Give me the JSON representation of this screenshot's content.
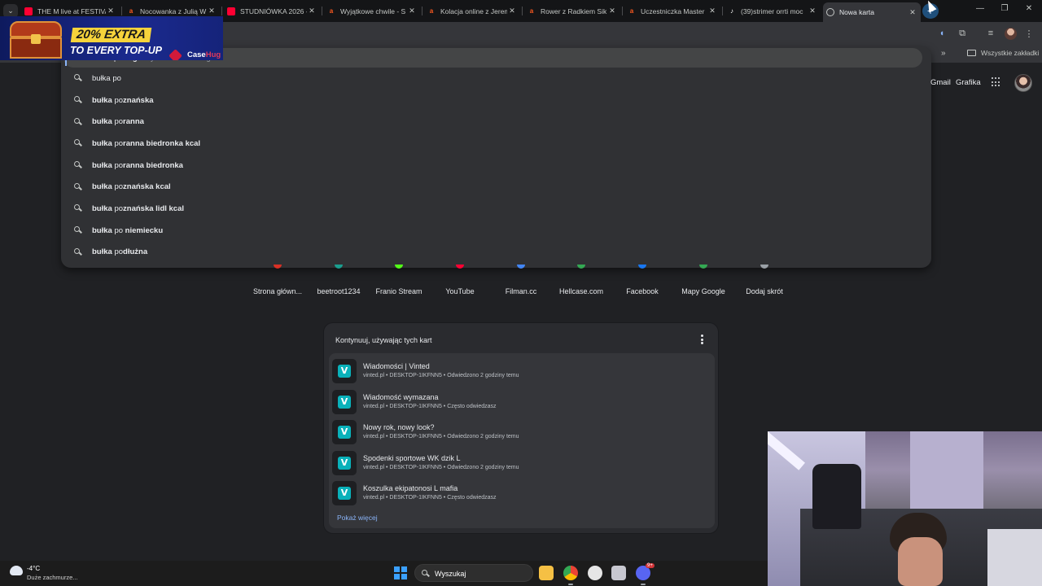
{
  "tabs": [
    {
      "label": "THE M live at FESTIVA",
      "favicon": "youtube-icon",
      "color": "#ff0033"
    },
    {
      "label": "Nocowanka z Julią W",
      "favicon": "kick-icon",
      "color": "#ff5a1f"
    },
    {
      "label": "STUDNIÓWKA 2026 -",
      "favicon": "youtube-icon",
      "color": "#ff0033"
    },
    {
      "label": "Wyjątkowe chwile - S",
      "favicon": "kick-icon",
      "color": "#ff5a1f"
    },
    {
      "label": "Kolacja online z Jerem",
      "favicon": "kick-icon",
      "color": "#ff5a1f"
    },
    {
      "label": "Rower z Radkiem Sik",
      "favicon": "kick-icon",
      "color": "#ff5a1f"
    },
    {
      "label": "Uczestniczka Master",
      "favicon": "kick-icon",
      "color": "#ff5a1f"
    },
    {
      "label": "(39)strimer orrti moc",
      "favicon": "tiktok-icon",
      "color": "#ffffff"
    },
    {
      "label": "Nowa karta",
      "favicon": "chrome-icon",
      "color": "#c4c7c5"
    }
  ],
  "bookmarks": {
    "all_label": "Wszystkie zakładki"
  },
  "ad": {
    "line1": "20% EXTRA",
    "line2": "TO EVERY TOP-UP",
    "brand_a": "Case",
    "brand_b": "Hug"
  },
  "omnibox": {
    "typed_bold_prefix": "bułka po ",
    "typed_bold": "ang",
    "typed_hint": " - Wyszukiwarka Google",
    "suggestions": [
      {
        "bold": "",
        "normal": "bułka po",
        "rest": ""
      },
      {
        "bold": "bułka",
        "normal": " po",
        "rest": "znańska"
      },
      {
        "bold": "bułka",
        "normal": " po",
        "rest": "ranna"
      },
      {
        "bold": "bułka",
        "normal": " po",
        "rest": "ranna biedronka kcal"
      },
      {
        "bold": "bułka",
        "normal": " po",
        "rest": "ranna biedronka"
      },
      {
        "bold": "bułka",
        "normal": " po",
        "rest": "znańska kcal"
      },
      {
        "bold": "bułka",
        "normal": " po",
        "rest": "znańska lidl kcal"
      },
      {
        "bold": "bułka",
        "normal": " po ",
        "rest": "niemiecku"
      },
      {
        "bold": "bułka",
        "normal": " po",
        "rest": "dłużna"
      }
    ]
  },
  "header_links": {
    "gmail": "Gmail",
    "images": "Grafika"
  },
  "shortcuts": [
    {
      "label": "Strona główn...",
      "color": "#d93025"
    },
    {
      "label": "beetroot1234",
      "color": "#1a9e8f"
    },
    {
      "label": "Franio Stream",
      "color": "#53fc18"
    },
    {
      "label": "YouTube",
      "color": "#ff0033"
    },
    {
      "label": "Filman.cc",
      "color": "#4285f4"
    },
    {
      "label": "Hellcase.com",
      "color": "#34a853"
    },
    {
      "label": "Facebook",
      "color": "#1877f2"
    },
    {
      "label": "Mapy Google",
      "color": "#34a853"
    },
    {
      "label": "Dodaj skrót",
      "color": "#9aa0a6"
    }
  ],
  "continue_card": {
    "title": "Kontynuuj, używając tych kart",
    "items": [
      {
        "title": "Wiadomości | Vinted",
        "meta": "vinted.pl • DESKTOP-1IKFNN5 • Odwiedzono 2 godziny temu"
      },
      {
        "title": "Wiadomość wymazana",
        "meta": "vinted.pl • DESKTOP-1IKFNN5 • Często odwiedzasz"
      },
      {
        "title": "Nowy rok, nowy look?",
        "meta": "vinted.pl • DESKTOP-1IKFNN5 • Odwiedzono 2 godziny temu"
      },
      {
        "title": "Spodenki sportowe WK dzik L",
        "meta": "vinted.pl • DESKTOP-1IKFNN5 • Odwiedzono 2 godziny temu"
      },
      {
        "title": "Koszulka ekipatonosi L mafia",
        "meta": "vinted.pl • DESKTOP-1IKFNN5 • Często odwiedzasz"
      }
    ],
    "icon_letter": "V",
    "show_more": "Pokaż więcej"
  },
  "taskbar": {
    "temp": "-4°C",
    "weather": "Duże zachmurze...",
    "search_placeholder": "Wyszukaj",
    "badge": "9+"
  }
}
